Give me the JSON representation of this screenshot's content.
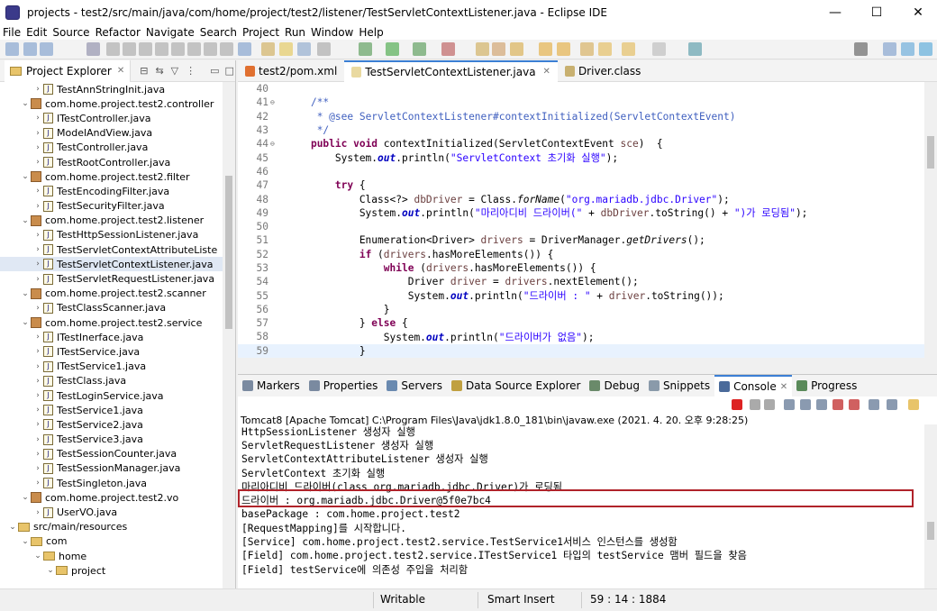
{
  "window": {
    "title": "projects - test2/src/main/java/com/home/project/test2/listener/TestServletContextListener.java - Eclipse IDE",
    "minimize": "—",
    "maximize": "☐",
    "close": "✕"
  },
  "menu": [
    "File",
    "Edit",
    "Source",
    "Refactor",
    "Navigate",
    "Search",
    "Project",
    "Run",
    "Window",
    "Help"
  ],
  "project_explorer": {
    "tab_label": "Project Explorer",
    "close": "✕",
    "items": [
      {
        "kind": "java",
        "label": "TestAnnStringInit.java",
        "indent": 2,
        "arrow": "›"
      },
      {
        "kind": "pkg",
        "label": "com.home.project.test2.controller",
        "indent": 1,
        "arrow": "⌄"
      },
      {
        "kind": "java",
        "label": "ITestController.java",
        "indent": 2,
        "arrow": "›"
      },
      {
        "kind": "java",
        "label": "ModelAndView.java",
        "indent": 2,
        "arrow": "›"
      },
      {
        "kind": "java",
        "label": "TestController.java",
        "indent": 2,
        "arrow": "›"
      },
      {
        "kind": "java",
        "label": "TestRootController.java",
        "indent": 2,
        "arrow": "›"
      },
      {
        "kind": "pkg",
        "label": "com.home.project.test2.filter",
        "indent": 1,
        "arrow": "⌄"
      },
      {
        "kind": "java",
        "label": "TestEncodingFilter.java",
        "indent": 2,
        "arrow": "›"
      },
      {
        "kind": "java",
        "label": "TestSecurityFilter.java",
        "indent": 2,
        "arrow": "›"
      },
      {
        "kind": "pkg",
        "label": "com.home.project.test2.listener",
        "indent": 1,
        "arrow": "⌄"
      },
      {
        "kind": "java",
        "label": "TestHttpSessionListener.java",
        "indent": 2,
        "arrow": "›"
      },
      {
        "kind": "java",
        "label": "TestServletContextAttributeListe",
        "indent": 2,
        "arrow": "›"
      },
      {
        "kind": "java",
        "label": "TestServletContextListener.java",
        "indent": 2,
        "arrow": "›",
        "selected": true
      },
      {
        "kind": "java",
        "label": "TestServletRequestListener.java",
        "indent": 2,
        "arrow": "›"
      },
      {
        "kind": "pkg",
        "label": "com.home.project.test2.scanner",
        "indent": 1,
        "arrow": "⌄"
      },
      {
        "kind": "java",
        "label": "TestClassScanner.java",
        "indent": 2,
        "arrow": "›"
      },
      {
        "kind": "pkg",
        "label": "com.home.project.test2.service",
        "indent": 1,
        "arrow": "⌄"
      },
      {
        "kind": "java",
        "label": "ITestInerface.java",
        "indent": 2,
        "arrow": "›"
      },
      {
        "kind": "java",
        "label": "ITestService.java",
        "indent": 2,
        "arrow": "›"
      },
      {
        "kind": "java",
        "label": "ITestService1.java",
        "indent": 2,
        "arrow": "›"
      },
      {
        "kind": "java",
        "label": "TestClass.java",
        "indent": 2,
        "arrow": "›"
      },
      {
        "kind": "java",
        "label": "TestLoginService.java",
        "indent": 2,
        "arrow": "›"
      },
      {
        "kind": "java",
        "label": "TestService1.java",
        "indent": 2,
        "arrow": "›"
      },
      {
        "kind": "java",
        "label": "TestService2.java",
        "indent": 2,
        "arrow": "›"
      },
      {
        "kind": "java",
        "label": "TestService3.java",
        "indent": 2,
        "arrow": "›"
      },
      {
        "kind": "java",
        "label": "TestSessionCounter.java",
        "indent": 2,
        "arrow": "›"
      },
      {
        "kind": "java",
        "label": "TestSessionManager.java",
        "indent": 2,
        "arrow": "›"
      },
      {
        "kind": "java",
        "label": "TestSingleton.java",
        "indent": 2,
        "arrow": "›"
      },
      {
        "kind": "pkg",
        "label": "com.home.project.test2.vo",
        "indent": 1,
        "arrow": "⌄"
      },
      {
        "kind": "java",
        "label": "UserVO.java",
        "indent": 2,
        "arrow": "›"
      },
      {
        "kind": "src",
        "label": "src/main/resources",
        "indent": 0,
        "arrow": "⌄"
      },
      {
        "kind": "folder",
        "label": "com",
        "indent": 1,
        "arrow": "⌄"
      },
      {
        "kind": "folder",
        "label": "home",
        "indent": 2,
        "arrow": "⌄"
      },
      {
        "kind": "folder",
        "label": "project",
        "indent": 3,
        "arrow": "⌄"
      }
    ]
  },
  "editor": {
    "tabs": [
      {
        "label": "test2/pom.xml",
        "active": false,
        "icon": "xml-file-icon"
      },
      {
        "label": "TestServletContextListener.java",
        "active": true,
        "icon": "java-file-icon",
        "close": "✕"
      },
      {
        "label": "Driver.class",
        "active": false,
        "icon": "class-file-icon"
      }
    ],
    "lines": [
      {
        "n": "40",
        "html": ""
      },
      {
        "n": "41",
        "fold": "⊖",
        "html": "    <span class='cmt'>/**</span>"
      },
      {
        "n": "42",
        "html": "     <span class='cmt'>* @see ServletContextListener#contextInitialized(ServletContextEvent)</span>"
      },
      {
        "n": "43",
        "html": "     <span class='cmt'>*/</span>"
      },
      {
        "n": "44",
        "fold": "⊖",
        "html": "    <span class='kw'>public void</span> contextInitialized(ServletContextEvent <span class='var'>sce</span>)  {"
      },
      {
        "n": "45",
        "html": "        System.<span class='fld'>out</span>.println(<span class='str'>\"ServletContext 초기화 실행\"</span>);"
      },
      {
        "n": "46",
        "html": ""
      },
      {
        "n": "47",
        "html": "        <span class='kw'>try</span> {"
      },
      {
        "n": "48",
        "html": "            Class&lt;?&gt; <span class='var'>dbDriver</span> = Class.<span class='ital'>forName</span>(<span class='str'>\"org.mariadb.jdbc.Driver\"</span>);"
      },
      {
        "n": "49",
        "html": "            System.<span class='fld'>out</span>.println(<span class='str'>\"마리아디비 드라이버(\"</span> + <span class='var'>dbDriver</span>.toString() + <span class='str'>\")가 로딩됨\"</span>);"
      },
      {
        "n": "50",
        "html": ""
      },
      {
        "n": "51",
        "html": "            Enumeration&lt;Driver&gt; <span class='var'>drivers</span> = DriverManager.<span class='ital'>getDrivers</span>();"
      },
      {
        "n": "52",
        "html": "            <span class='kw'>if</span> (<span class='var'>drivers</span>.hasMoreElements()) {"
      },
      {
        "n": "53",
        "html": "                <span class='kw'>while</span> (<span class='var'>drivers</span>.hasMoreElements()) {"
      },
      {
        "n": "54",
        "html": "                    Driver <span class='var'>driver</span> = <span class='var'>drivers</span>.nextElement();"
      },
      {
        "n": "55",
        "html": "                    System.<span class='fld'>out</span>.println(<span class='str'>\"드라이버 : \"</span> + <span class='var'>driver</span>.toString());"
      },
      {
        "n": "56",
        "html": "                }"
      },
      {
        "n": "57",
        "html": "            } <span class='kw'>else</span> {"
      },
      {
        "n": "58",
        "html": "                System.<span class='fld'>out</span>.println(<span class='str'>\"드라이버가 없음\"</span>);"
      },
      {
        "n": "59",
        "html": "            }",
        "current": true
      }
    ]
  },
  "console_panel": {
    "tabs": [
      {
        "label": "Markers",
        "icon": "markers-icon"
      },
      {
        "label": "Properties",
        "icon": "properties-icon"
      },
      {
        "label": "Servers",
        "icon": "servers-icon"
      },
      {
        "label": "Data Source Explorer",
        "icon": "data-source-icon"
      },
      {
        "label": "Debug",
        "icon": "debug-icon"
      },
      {
        "label": "Snippets",
        "icon": "snippets-icon"
      },
      {
        "label": "Console",
        "icon": "console-icon",
        "active": true,
        "close": "✕"
      },
      {
        "label": "Progress",
        "icon": "progress-icon"
      }
    ],
    "launch_info": "Tomcat8 [Apache Tomcat] C:\\Program Files\\Java\\jdk1.8.0_181\\bin\\javaw.exe  (2021. 4. 20. 오후 9:28:25)",
    "lines": [
      "HttpSessionListener 생성자 실행",
      "ServletRequestListener 생성자 실행",
      "ServletContextAttributeListener 생성자 실행",
      "ServletContext 초기화 실행",
      "마리아디비 드라이버(class org.mariadb.jdbc.Driver)가 로딩됨",
      "드라이버 : org.mariadb.jdbc.Driver@5f0e7bc4",
      "basePackage : com.home.project.test2",
      "[RequestMapping]를 시작합니다.",
      "[Service] com.home.project.test2.service.TestService1서비스 인스턴스를 생성함",
      "[Field] com.home.project.test2.service.ITestService1 타입의 testService 맴버 필드을 찾음",
      "[Field] testService에 의존성 주입을 처리함"
    ],
    "highlight_color": "#b0232a"
  },
  "status": {
    "writable": "Writable",
    "insert_mode": "Smart Insert",
    "position": "59 : 14 : 1884"
  }
}
